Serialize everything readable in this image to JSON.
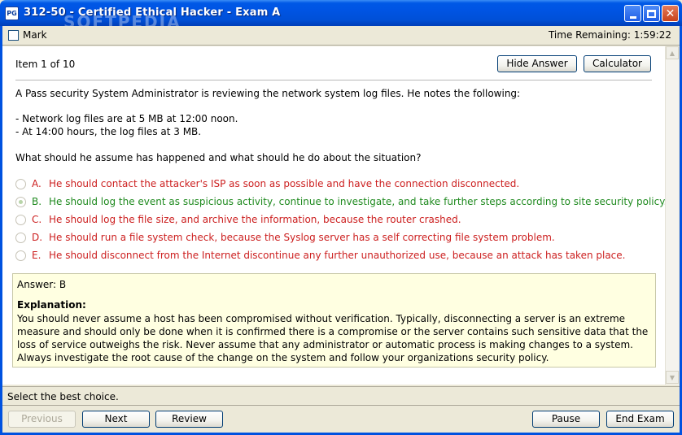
{
  "window": {
    "title": "312-50 - Certified Ethical Hacker - Exam A",
    "app_icon": "PG",
    "watermark": "SOFTPEDIA",
    "min_icon": "minimize-icon",
    "max_icon": "maximize-icon",
    "close_icon": "close-icon",
    "close_glyph": "✕"
  },
  "header": {
    "mark_label": "Mark",
    "time_remaining": "Time Remaining: 1:59:22"
  },
  "item": {
    "counter": "Item 1 of 10",
    "hide_answer_label": "Hide Answer",
    "calculator_label": "Calculator"
  },
  "question": {
    "intro": "A Pass security System Administrator is reviewing the network system log files. He notes the following:",
    "line1": "- Network log files are at 5 MB at 12:00 noon.",
    "line2": "- At 14:00 hours, the log files at 3 MB.",
    "prompt": "What should he assume has happened and what should he do about the situation?"
  },
  "options": [
    {
      "letter": "A.",
      "text": "He should contact the attacker's ISP as soon as possible and have the connection disconnected.",
      "correct": false
    },
    {
      "letter": "B.",
      "text": "He should log the event as suspicious activity, continue to investigate, and take further steps according to site security policy.",
      "correct": true
    },
    {
      "letter": "C.",
      "text": "He should log the file size, and archive the information, because the router crashed.",
      "correct": false
    },
    {
      "letter": "D.",
      "text": "He should run a file system check, because the Syslog server has a self correcting file system problem.",
      "correct": false
    },
    {
      "letter": "E.",
      "text": "He should disconnect from the Internet discontinue any further unauthorized use, because an attack has taken place.",
      "correct": false
    }
  ],
  "answer": {
    "label": "Answer: B",
    "explanation_title": "Explanation:",
    "explanation_text": "You should never assume a host has been compromised without verification. Typically, disconnecting a server is an extreme measure and should only be done when it is confirmed there is a compromise or the server contains such sensitive data that the loss of service outweighs the risk. Never assume that any administrator or automatic process is making changes to a system. Always investigate the root cause of the change on the system and follow your organizations security policy."
  },
  "status": {
    "text": "Select the best choice."
  },
  "footer": {
    "previous_label": "Previous",
    "next_label": "Next",
    "review_label": "Review",
    "pause_label": "Pause",
    "end_exam_label": "End Exam"
  },
  "colors": {
    "incorrect_option": "#cc1f1f",
    "correct_option": "#1f8a1f",
    "answer_background": "#ffffe1",
    "titlebar": "#0054e3"
  },
  "scrollbar": {
    "up_glyph": "▲",
    "down_glyph": "▼"
  }
}
